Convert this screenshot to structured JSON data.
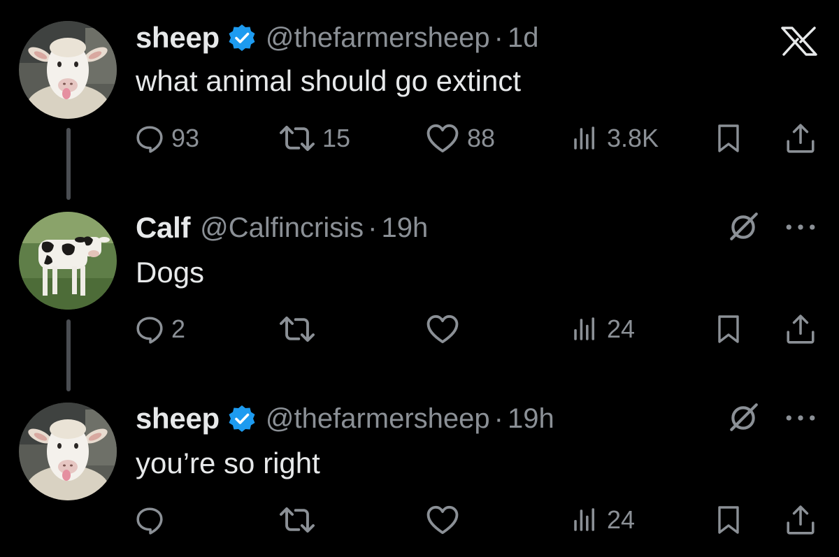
{
  "tweets": [
    {
      "name": "sheep",
      "verified": true,
      "handle": "@thefarmersheep",
      "separator": "·",
      "time": "1d",
      "text": "what animal should go extinct",
      "stats": {
        "replies": "93",
        "reposts": "15",
        "likes": "88",
        "views": "3.8K"
      },
      "avatar": "sheep-avatar"
    },
    {
      "name": "Calf",
      "verified": false,
      "handle": "@Calfincrisis",
      "separator": "·",
      "time": "19h",
      "text": "Dogs",
      "stats": {
        "replies": "2",
        "reposts": "",
        "likes": "",
        "views": "24"
      },
      "avatar": "calf-avatar"
    },
    {
      "name": "sheep",
      "verified": true,
      "handle": "@thefarmersheep",
      "separator": "·",
      "time": "19h",
      "text": "you’re so right",
      "stats": {
        "replies": "",
        "reposts": "",
        "likes": "",
        "views": "24"
      },
      "avatar": "sheep-avatar"
    }
  ],
  "colors": {
    "background": "#000000",
    "text": "#e7e9ea",
    "muted": "#8b9096",
    "verified": "#1d9bf0"
  },
  "icons": [
    "x-logo-icon",
    "grok-icon",
    "more-icon",
    "reply-icon",
    "repost-icon",
    "like-icon",
    "views-icon",
    "bookmark-icon",
    "share-icon",
    "verified-badge-icon"
  ]
}
